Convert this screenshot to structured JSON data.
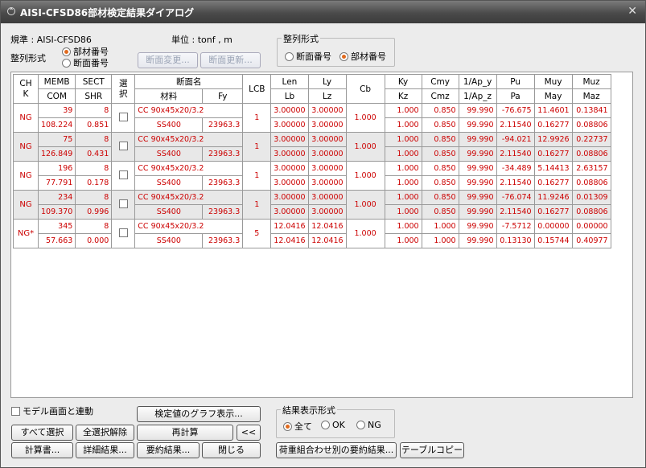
{
  "window": {
    "title": "AISI-CFSD86部材検定結果ダイアログ"
  },
  "info": {
    "standard": "規準 : AISI-CFSD86",
    "unit": "単位 :  tonf   ,    m",
    "sort_label": "整列形式",
    "sort_options": [
      "部材番号",
      "断面番号"
    ]
  },
  "buttons": {
    "section_change": "断面変更...",
    "section_update": "断面更新..."
  },
  "sort_group": {
    "title": "整列形式",
    "options": [
      "断面番号",
      "部材番号"
    ]
  },
  "table": {
    "headers": {
      "chk": "CH K",
      "memb": "MEMB",
      "com": "COM",
      "sect": "SECT",
      "shr": "SHR",
      "sel": "選 択",
      "section_name": "断面名",
      "material": "材料",
      "fy": "Fy",
      "lcb": "LCB",
      "len": "Len",
      "lb": "Lb",
      "ly": "Ly",
      "lz": "Lz",
      "cb": "Cb",
      "ky": "Ky",
      "kz": "Kz",
      "cmy": "Cmy",
      "cmz": "Cmz",
      "apy": "1/Ap_y",
      "apz": "1/Ap_z",
      "pu": "Pu",
      "pa": "Pa",
      "muy": "Muy",
      "may": "May",
      "muz": "Muz",
      "maz": "Maz"
    },
    "rows": [
      {
        "chk": "NG",
        "memb": "39",
        "com": "108.224",
        "sect": "8",
        "shr": "0.851",
        "section": "CC 90x45x20/3.2",
        "material": "SS400",
        "fy": "23963.3",
        "lcb": "1",
        "len": "3.00000",
        "lb": "3.00000",
        "ly": "3.00000",
        "lz": "3.00000",
        "cb": "1.000",
        "ky": "1.000",
        "kz": "1.000",
        "cmy": "0.850",
        "cmz": "0.850",
        "apy": "99.990",
        "apz": "99.990",
        "pu": "-76.675",
        "pa": "2.11540",
        "muy": "11.4601",
        "may": "0.16277",
        "muz": "0.13841",
        "maz": "0.08806"
      },
      {
        "chk": "NG",
        "memb": "75",
        "com": "126.849",
        "sect": "8",
        "shr": "0.431",
        "section": "CC 90x45x20/3.2",
        "material": "SS400",
        "fy": "23963.3",
        "lcb": "1",
        "len": "3.00000",
        "lb": "3.00000",
        "ly": "3.00000",
        "lz": "3.00000",
        "cb": "1.000",
        "ky": "1.000",
        "kz": "1.000",
        "cmy": "0.850",
        "cmz": "0.850",
        "apy": "99.990",
        "apz": "99.990",
        "pu": "-94.021",
        "pa": "2.11540",
        "muy": "12.9926",
        "may": "0.16277",
        "muz": "0.22737",
        "maz": "0.08806"
      },
      {
        "chk": "NG",
        "memb": "196",
        "com": "77.791",
        "sect": "8",
        "shr": "0.178",
        "section": "CC 90x45x20/3.2",
        "material": "SS400",
        "fy": "23963.3",
        "lcb": "1",
        "len": "3.00000",
        "lb": "3.00000",
        "ly": "3.00000",
        "lz": "3.00000",
        "cb": "1.000",
        "ky": "1.000",
        "kz": "1.000",
        "cmy": "0.850",
        "cmz": "0.850",
        "apy": "99.990",
        "apz": "99.990",
        "pu": "-34.489",
        "pa": "2.11540",
        "muy": "5.14413",
        "may": "0.16277",
        "muz": "2.63157",
        "maz": "0.08806"
      },
      {
        "chk": "NG",
        "memb": "234",
        "com": "109.370",
        "sect": "8",
        "shr": "0.996",
        "section": "CC 90x45x20/3.2",
        "material": "SS400",
        "fy": "23963.3",
        "lcb": "1",
        "len": "3.00000",
        "lb": "3.00000",
        "ly": "3.00000",
        "lz": "3.00000",
        "cb": "1.000",
        "ky": "1.000",
        "kz": "1.000",
        "cmy": "0.850",
        "cmz": "0.850",
        "apy": "99.990",
        "apz": "99.990",
        "pu": "-76.074",
        "pa": "2.11540",
        "muy": "11.9246",
        "may": "0.16277",
        "muz": "0.01309",
        "maz": "0.08806"
      },
      {
        "chk": "NG*",
        "memb": "345",
        "com": "57.663",
        "sect": "8",
        "shr": "0.000",
        "section": "CC 90x45x20/3.2",
        "material": "SS400",
        "fy": "23963.3",
        "lcb": "5",
        "len": "12.0416",
        "lb": "12.0416",
        "ly": "12.0416",
        "lz": "12.0416",
        "cb": "1.000",
        "ky": "1.000",
        "kz": "1.000",
        "cmy": "1.000",
        "cmz": "1.000",
        "apy": "99.990",
        "apz": "99.990",
        "pu": "-7.5712",
        "pa": "0.13130",
        "muy": "0.00000",
        "may": "0.15744",
        "muz": "0.00000",
        "maz": "0.40977"
      }
    ]
  },
  "bottom": {
    "link_model": "モデル画面と連動",
    "graph": "検定値のグラフ表示...",
    "select_all": "すべて選択",
    "deselect_all": "全選択解除",
    "recalc": "再計算",
    "collapse": "<<",
    "calc_book": "計算書...",
    "detail": "詳細結果...",
    "summary": "要約結果...",
    "close": "閉じる",
    "result_group_title": "結果表示形式",
    "result_options": [
      "全て",
      "OK",
      "NG"
    ],
    "load_combo_summary": "荷重組合わせ別の要約結果...",
    "table_copy": "テーブルコピー"
  }
}
